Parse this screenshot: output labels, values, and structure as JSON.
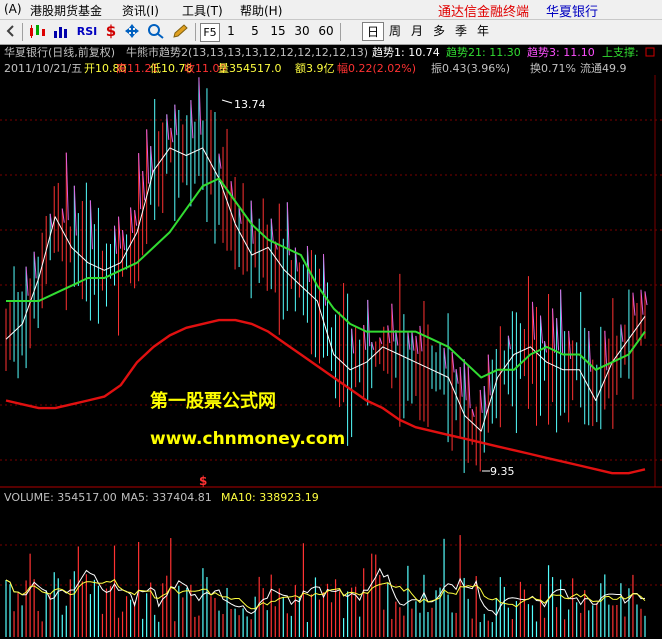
{
  "menu": {
    "items": [
      "(A)",
      "港股期货基金",
      "资讯(I)",
      "工具(T)",
      "帮助(H)"
    ],
    "brand": "通达信金融终端",
    "stock": "华夏银行"
  },
  "toolbar": {
    "indicator_label": "RSI",
    "f5_label": "F5",
    "intervals": [
      "1",
      "5",
      "15",
      "30",
      "60"
    ],
    "periods": [
      "日",
      "周",
      "月",
      "多",
      "季",
      "年"
    ],
    "active_period": "日"
  },
  "header": {
    "title": "华夏银行(日线,前复权)",
    "formula": "牛熊市趋势2(13,13,13,13,12,12,12,12,12,13)",
    "trend1": "趋势1: 10.74",
    "trend21": "趋势21: 11.30",
    "trend3": "趋势3: 11.10",
    "support": "上支撑:",
    "date": "2011/10/21/五",
    "open": "开10.80",
    "high": "高11.21",
    "low": "低10.78",
    "close": "收11.09",
    "volume": "量354517.0",
    "amount": "额3.9亿",
    "change": "幅0.22(2.02%)",
    "amplitude": "振0.43(3.96%)",
    "turnover": "换0.71%",
    "float": "流通49.9"
  },
  "annotations": {
    "high_mark": "13.74",
    "low_mark": "9.35",
    "watermark_title": "第一股票公式网",
    "watermark_url": "www.chnmoney.com",
    "dollar_mark": "$"
  },
  "volume_header": {
    "volume": "VOLUME: 354517.00",
    "ma5": "MA5: 337404.81",
    "ma10": "MA10: 338923.19"
  },
  "colors": {
    "up": "#ff3232",
    "down": "#54ffff",
    "kline_up": "#e060e0",
    "trend1_white": "#ffffff",
    "trend21_green": "#32dc32",
    "trend3_red": "#e01010",
    "watermark": "#ffff00",
    "menu_brand": "#e00000"
  },
  "chart_data": {
    "type": "line",
    "price_ylim": [
      9.0,
      14.2
    ],
    "volume_ylim": [
      0,
      700000
    ],
    "grid": true,
    "series": [
      {
        "name": "趋势1",
        "values": [
          10.8,
          11.0,
          11.6,
          12.4,
          12.0,
          11.8,
          11.7,
          11.8,
          12.2,
          13.0,
          13.3,
          13.2,
          13.3,
          12.9,
          12.3,
          11.9,
          12.0,
          11.7,
          11.5,
          11.3,
          10.6,
          10.4,
          10.5,
          10.7,
          10.6,
          10.5,
          10.4,
          10.3,
          9.8,
          9.6,
          10.3,
          10.6,
          10.7,
          10.5,
          10.4,
          10.4,
          10.0,
          10.5,
          10.8,
          11.1
        ]
      },
      {
        "name": "趋势21",
        "values": [
          11.3,
          11.3,
          11.3,
          11.4,
          11.5,
          11.6,
          11.6,
          11.7,
          11.8,
          12.0,
          12.2,
          12.5,
          12.8,
          12.9,
          12.6,
          12.3,
          12.1,
          12.0,
          11.9,
          11.5,
          11.2,
          11.0,
          10.9,
          10.9,
          10.9,
          10.9,
          10.8,
          10.7,
          10.5,
          10.3,
          10.4,
          10.4,
          10.6,
          10.7,
          10.6,
          10.6,
          10.4,
          10.5,
          10.6,
          10.9
        ]
      },
      {
        "name": "趋势3",
        "values": [
          10.0,
          9.95,
          9.9,
          9.9,
          9.95,
          10.0,
          10.05,
          10.2,
          10.5,
          10.7,
          10.85,
          10.95,
          11.0,
          11.05,
          11.05,
          11.0,
          10.9,
          10.75,
          10.6,
          10.45,
          10.3,
          10.15,
          10.0,
          9.9,
          9.75,
          9.65,
          9.6,
          9.55,
          9.5,
          9.45,
          9.4,
          9.35,
          9.3,
          9.25,
          9.2,
          9.15,
          9.1,
          9.05,
          9.05,
          9.1
        ]
      }
    ]
  }
}
